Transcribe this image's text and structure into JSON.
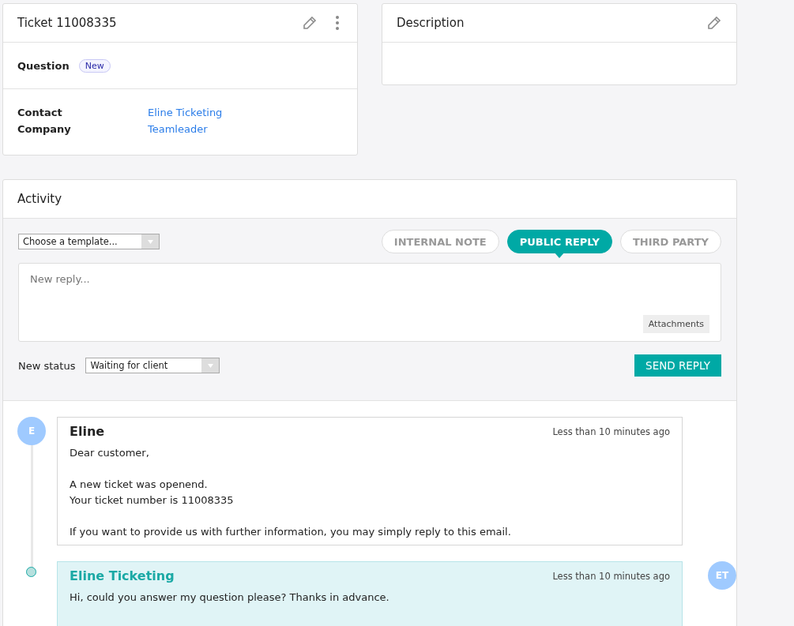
{
  "ticket": {
    "title": "Ticket 11008335",
    "type": "Question",
    "badge": "New",
    "fields": [
      {
        "label": "Contact",
        "value": "Eline Ticketing"
      },
      {
        "label": "Company",
        "value": "Teamleader"
      }
    ]
  },
  "description": {
    "title": "Description"
  },
  "activity": {
    "title": "Activity",
    "template": {
      "value": "Choose a template..."
    },
    "tabs": [
      {
        "label": "INTERNAL NOTE",
        "selected": false
      },
      {
        "label": "PUBLIC REPLY",
        "selected": true
      },
      {
        "label": "THIRD PARTY",
        "selected": false
      }
    ],
    "reply": {
      "placeholder": "New reply..."
    },
    "attachments": "Attachments",
    "status_label": "New status",
    "status": {
      "value": "Waiting for client"
    },
    "send": "SEND REPLY",
    "messages": [
      {
        "kind": "customer",
        "author": "Eline",
        "avatar": "E",
        "time": "Less than 10 minutes ago",
        "paragraphs": [
          [
            "Dear customer,"
          ],
          [
            "A new ticket was openend.",
            "Your ticket number is 11008335"
          ],
          [
            "If you want to provide us with further information, you may simply reply to this email."
          ]
        ]
      },
      {
        "kind": "contact",
        "author": "Eline Ticketing",
        "avatar": "ET",
        "time": "Less than 10 minutes ago",
        "paragraphs": [
          [
            "Hi, could you answer my question please? Thanks in advance."
          ]
        ]
      }
    ]
  }
}
